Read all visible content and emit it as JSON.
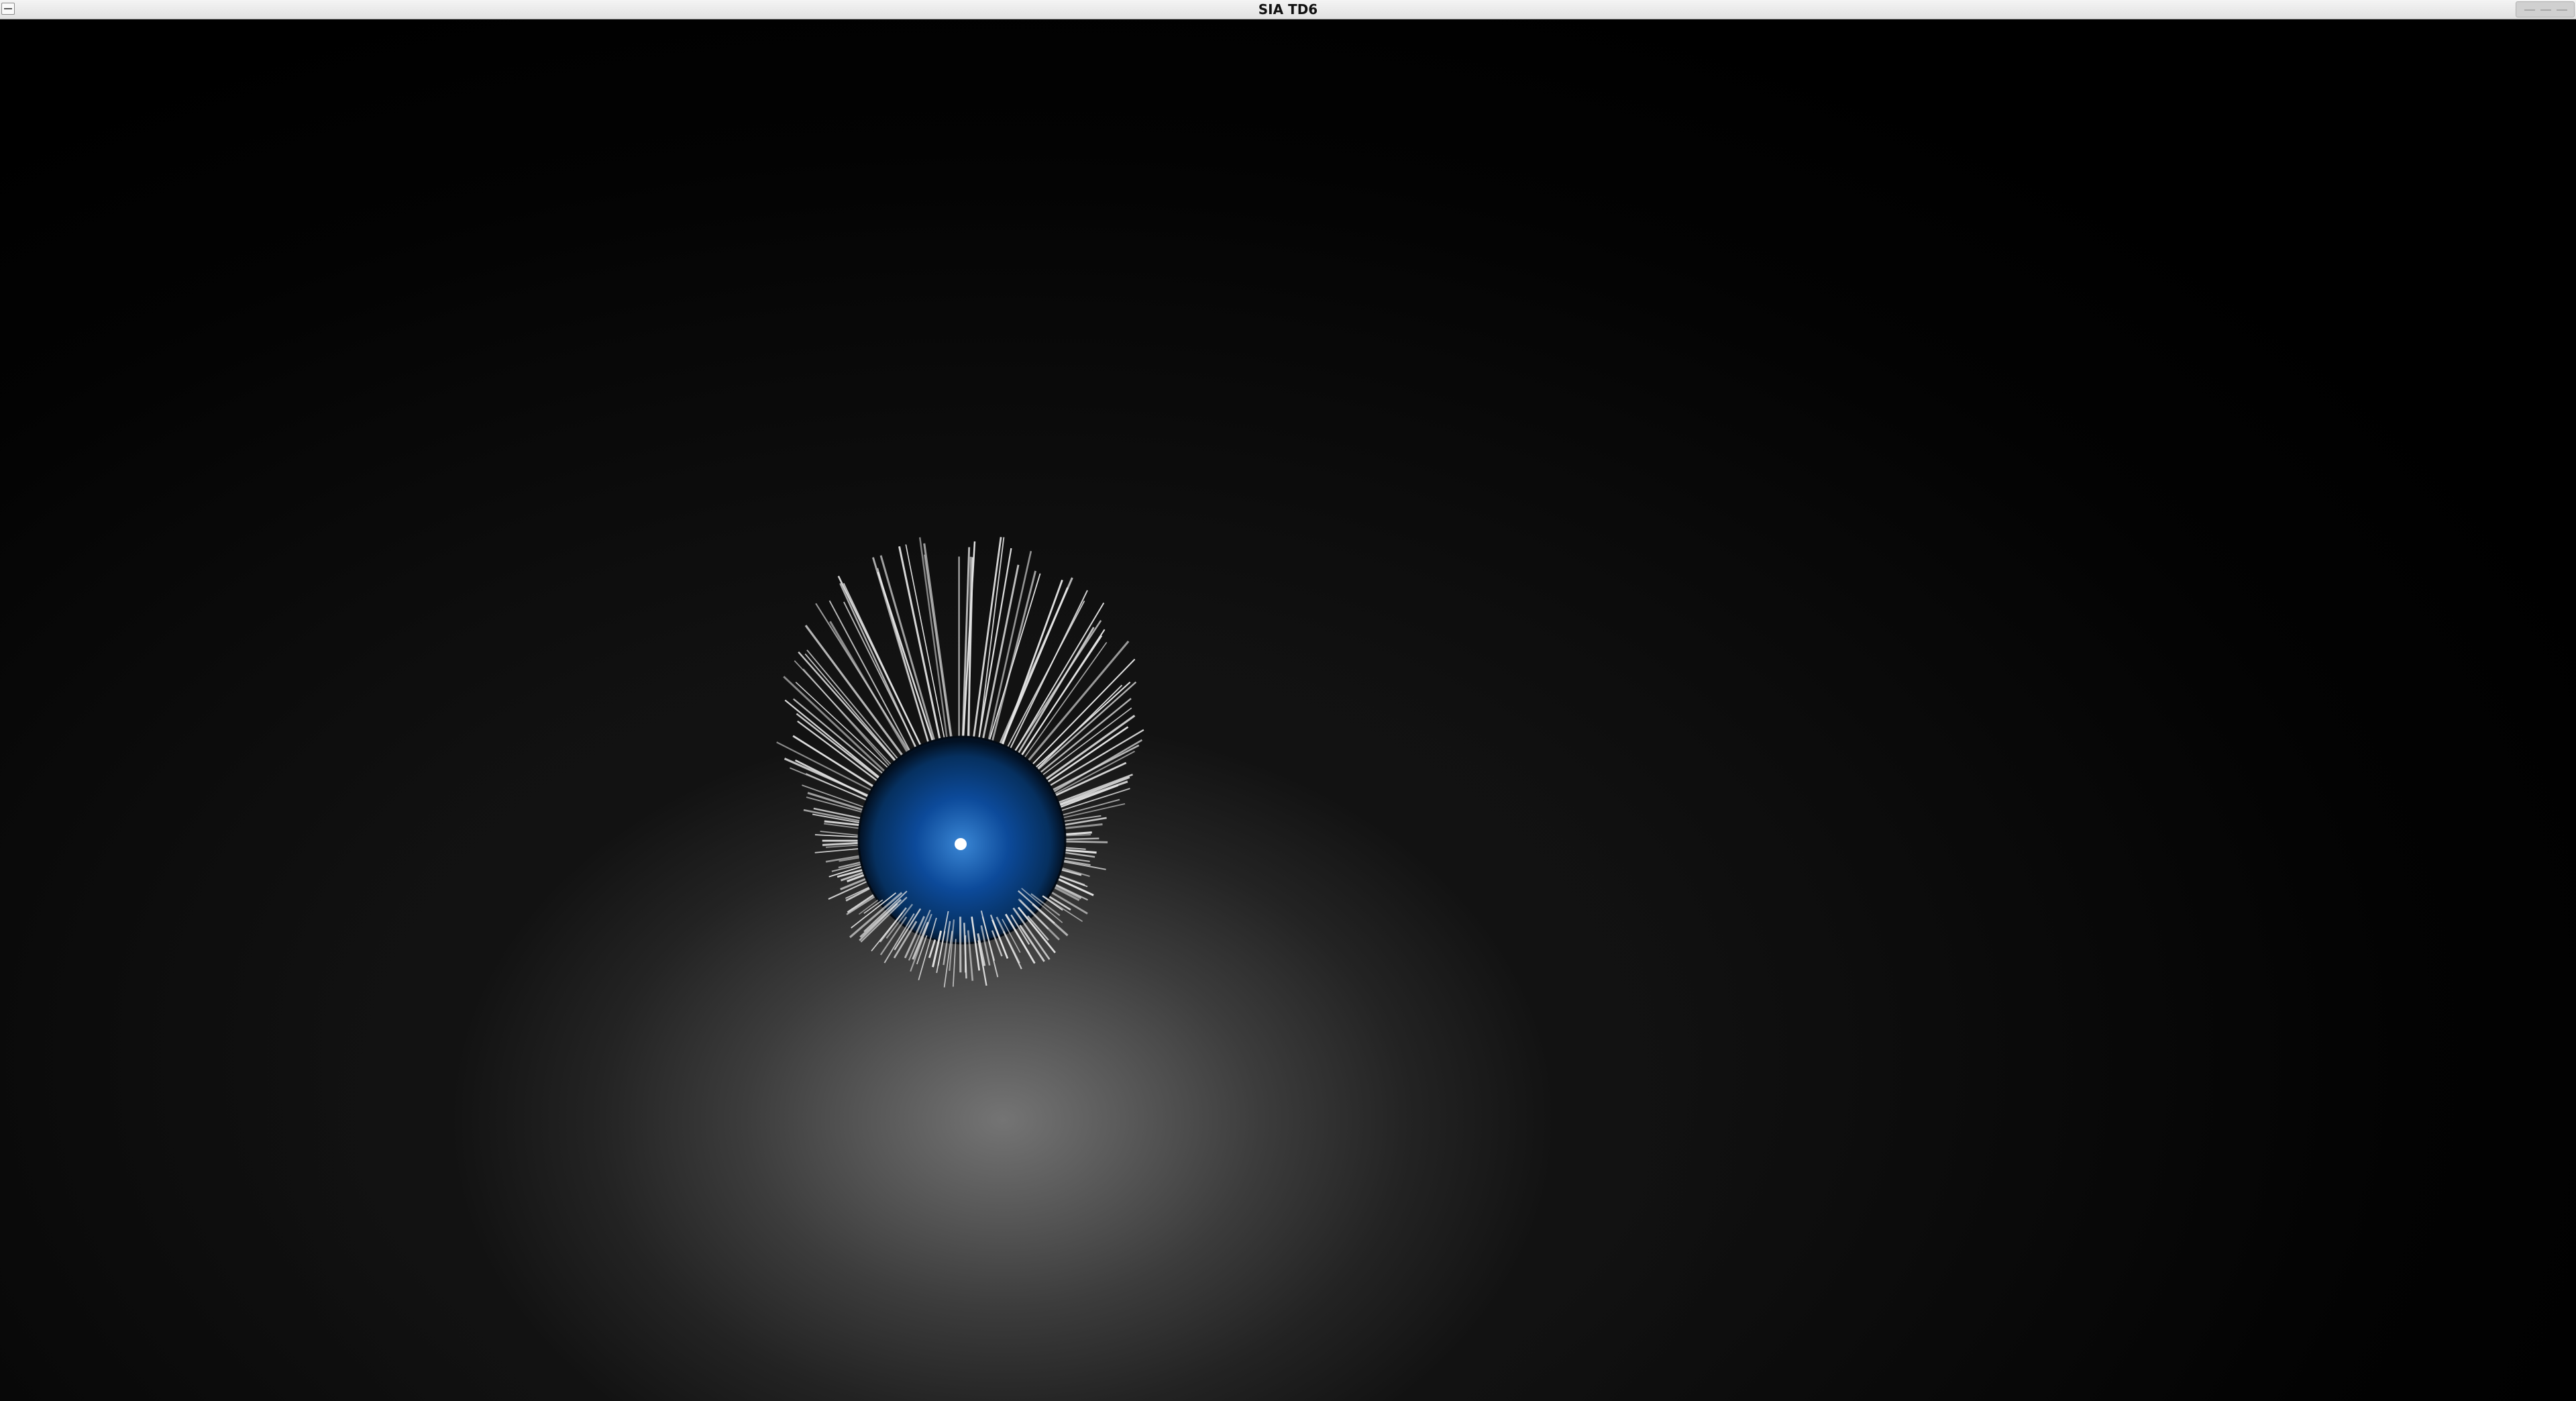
{
  "window": {
    "title": "SIA TD6"
  },
  "scene": {
    "sphere_color": "#0c4a9a",
    "sphere_highlight_color": "#3a86d4",
    "hair_color": "#e6e6e6",
    "light_marker_color": "#ffffff",
    "floor_glow_color": "#747474",
    "background_color": "#000000"
  }
}
